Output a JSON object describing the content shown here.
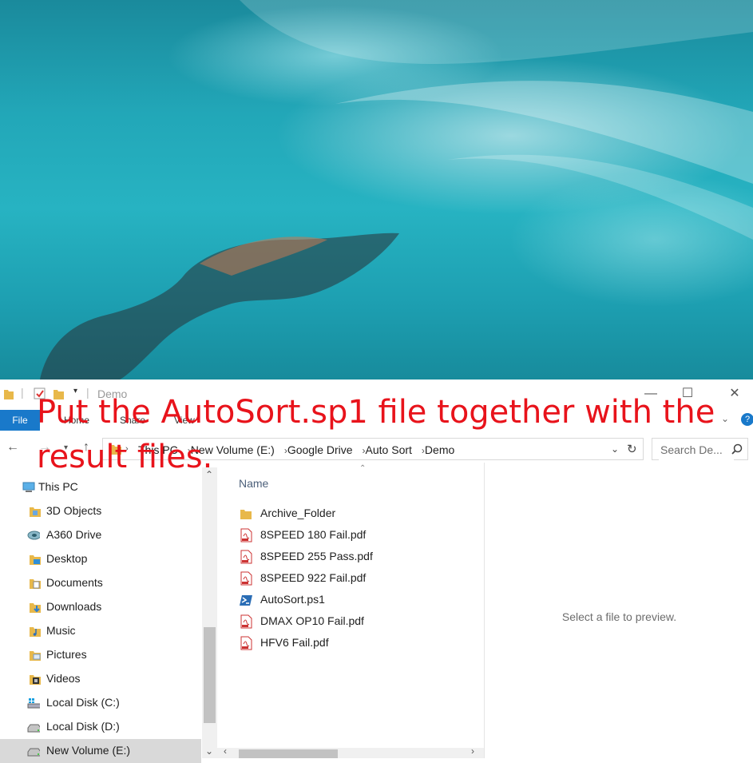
{
  "window": {
    "title": "Demo",
    "minimize": "—",
    "maximize": "☐",
    "close": "✕"
  },
  "ribbon": {
    "file_tab": "File",
    "tabs": [
      "Home",
      "Share",
      "View"
    ],
    "help": "?"
  },
  "address": {
    "crumbs": [
      "This PC",
      "New Volume (E:)",
      "Google Drive",
      "Auto Sort",
      "Demo"
    ],
    "search_placeholder": "Search De..."
  },
  "nav": {
    "items": [
      {
        "label": "This PC",
        "icon": "computer-icon"
      },
      {
        "label": "3D Objects",
        "icon": "folder-icon"
      },
      {
        "label": "A360 Drive",
        "icon": "cloud-drive-icon"
      },
      {
        "label": "Desktop",
        "icon": "desktop-folder-icon"
      },
      {
        "label": "Documents",
        "icon": "documents-folder-icon"
      },
      {
        "label": "Downloads",
        "icon": "downloads-folder-icon"
      },
      {
        "label": "Music",
        "icon": "music-folder-icon"
      },
      {
        "label": "Pictures",
        "icon": "pictures-folder-icon"
      },
      {
        "label": "Videos",
        "icon": "videos-folder-icon"
      },
      {
        "label": "Local Disk (C:)",
        "icon": "windows-drive-icon"
      },
      {
        "label": "Local Disk (D:)",
        "icon": "drive-icon"
      },
      {
        "label": "New Volume (E:)",
        "icon": "drive-icon"
      }
    ]
  },
  "content": {
    "column_header": "Name",
    "files": [
      {
        "name": "Archive_Folder",
        "icon": "folder-icon"
      },
      {
        "name": "8SPEED 180 Fail.pdf",
        "icon": "pdf-icon"
      },
      {
        "name": "8SPEED 255 Pass.pdf",
        "icon": "pdf-icon"
      },
      {
        "name": "8SPEED 922 Fail.pdf",
        "icon": "pdf-icon"
      },
      {
        "name": "AutoSort.ps1",
        "icon": "powershell-icon"
      },
      {
        "name": "DMAX OP10 Fail.pdf",
        "icon": "pdf-icon"
      },
      {
        "name": "HFV6 Fail.pdf",
        "icon": "pdf-icon"
      }
    ]
  },
  "preview": {
    "message": "Select a file to preview."
  },
  "overlay": {
    "caption": "Put the AutoSort.sp1 file together with the result files.",
    "color": "#e8131b"
  }
}
